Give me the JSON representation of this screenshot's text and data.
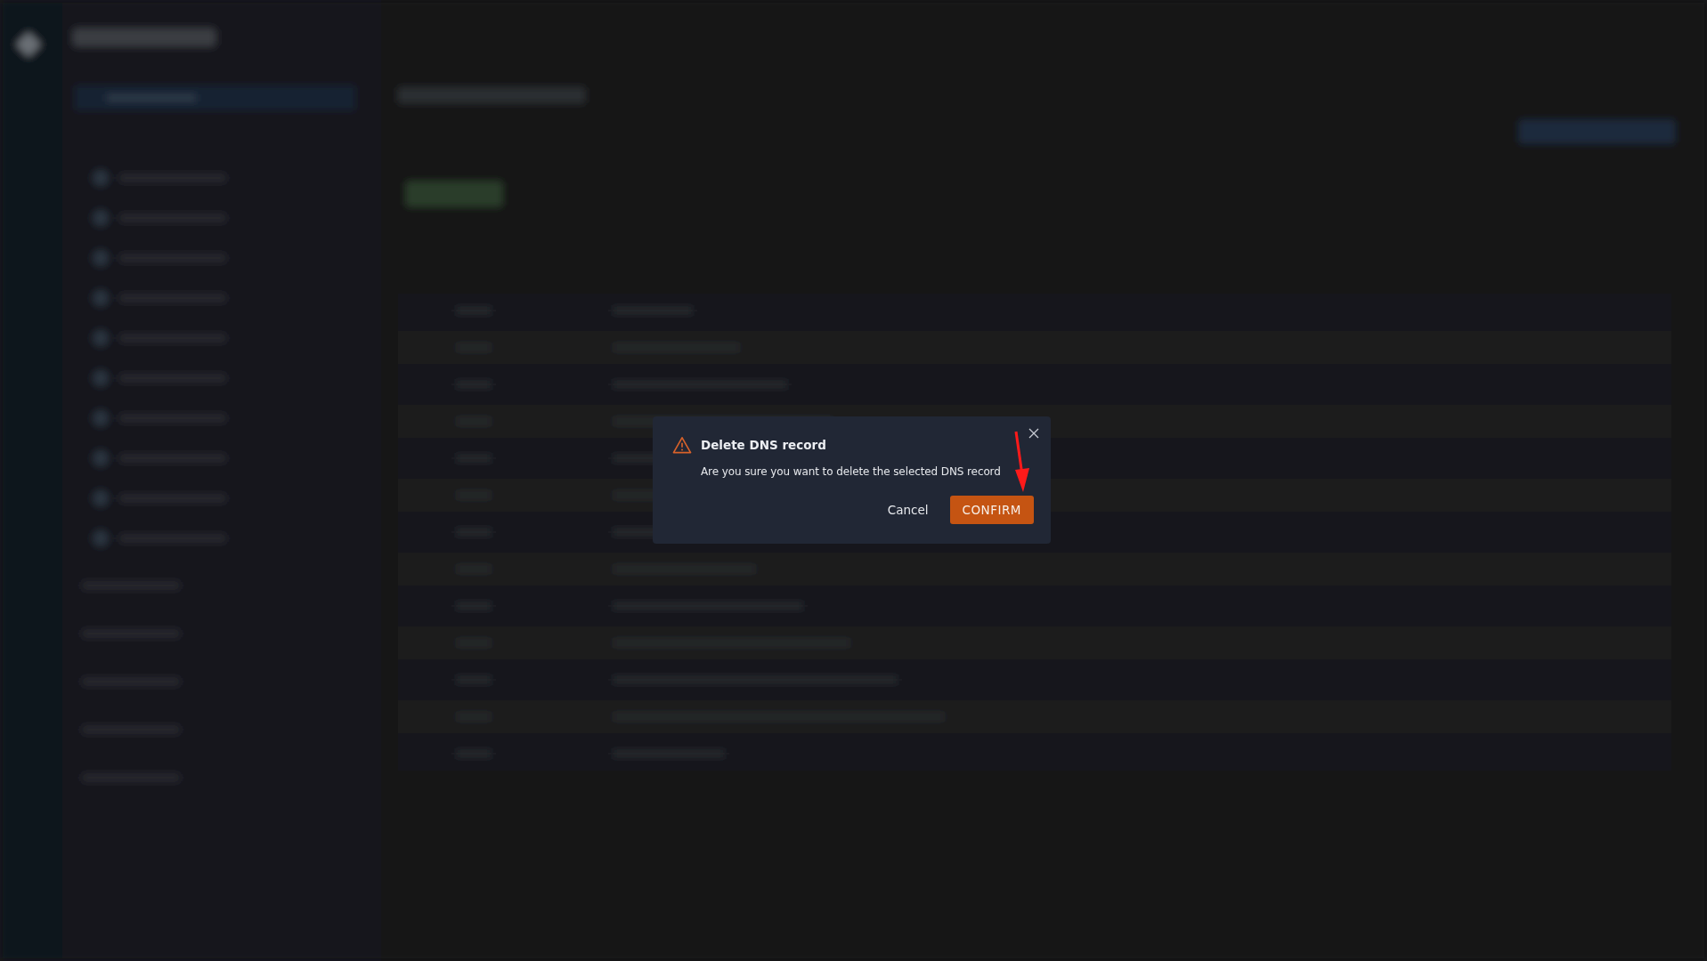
{
  "dialog": {
    "title": "Delete DNS record",
    "message": "Are you sure you want to delete the selected DNS record",
    "buttons": [
      {
        "label": "Cancel",
        "kind": "text"
      },
      {
        "label": "CONFIRM",
        "kind": "primary"
      }
    ]
  }
}
